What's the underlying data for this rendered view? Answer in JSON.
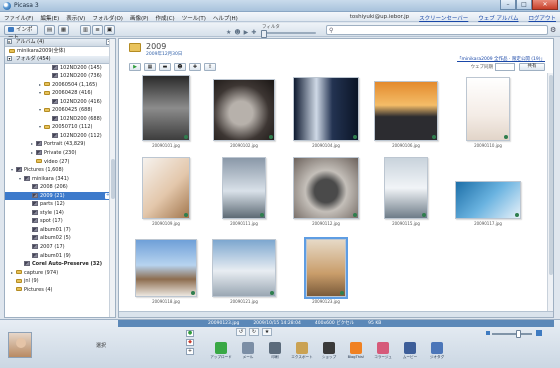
{
  "window": {
    "title": "Picasa 3",
    "controls": {
      "minimize": "–",
      "maximize": "□",
      "close": "✕"
    }
  },
  "menu": {
    "items": [
      "ファイル(F)",
      "編集(E)",
      "表示(V)",
      "フォルダ(O)",
      "画像(P)",
      "作成(C)",
      "ツール(T)",
      "ヘルプ(H)"
    ],
    "email": "toshiyuki@up.iebor.jp",
    "links": [
      "スクリーンセーバー",
      "ウェブ アルバム",
      "ログアウト"
    ]
  },
  "toolbar": {
    "import_label": "インポート",
    "filter_label": "フィルタ",
    "search_placeholder": ""
  },
  "tree": {
    "albums_header": "アルバム (4)",
    "folders_header": "フォルダ (454)",
    "rows": [
      {
        "label": "minikara2009(全体)",
        "indent": 4,
        "kind": "folder",
        "tri": ""
      },
      {
        "label": "102ND200 (145)",
        "indent": 42,
        "kind": "thumb",
        "tri": ""
      },
      {
        "label": "102ND200 (736)",
        "indent": 42,
        "kind": "thumb",
        "tri": ""
      },
      {
        "label": "20060504 (1,165)",
        "indent": 34,
        "kind": "folder",
        "tri": "▸"
      },
      {
        "label": "20060428 (416)",
        "indent": 34,
        "kind": "folder",
        "tri": "▾"
      },
      {
        "label": "102ND200 (416)",
        "indent": 42,
        "kind": "thumb",
        "tri": ""
      },
      {
        "label": "20060425 (688)",
        "indent": 34,
        "kind": "folder",
        "tri": "▾"
      },
      {
        "label": "102ND200 (688)",
        "indent": 42,
        "kind": "thumb",
        "tri": ""
      },
      {
        "label": "20050710 (112)",
        "indent": 34,
        "kind": "folder",
        "tri": "▾"
      },
      {
        "label": "102ND200 (112)",
        "indent": 42,
        "kind": "thumb",
        "tri": ""
      },
      {
        "label": "Portrait (43,829)",
        "indent": 26,
        "kind": "thumb",
        "tri": "▸"
      },
      {
        "label": "Private (230)",
        "indent": 26,
        "kind": "thumb",
        "tri": "▸"
      },
      {
        "label": "video (27)",
        "indent": 26,
        "kind": "folder",
        "tri": ""
      },
      {
        "label": "Pictures (1,608)",
        "indent": 6,
        "kind": "thumb",
        "tri": "▾"
      },
      {
        "label": "minikara (341)",
        "indent": 14,
        "kind": "thumb",
        "tri": "▾"
      },
      {
        "label": "2008 (206)",
        "indent": 22,
        "kind": "thumb",
        "tri": ""
      },
      {
        "label": "2009 (21)",
        "indent": 22,
        "kind": "thumb",
        "tri": "",
        "selected": true
      },
      {
        "label": "parts (12)",
        "indent": 22,
        "kind": "thumb",
        "tri": ""
      },
      {
        "label": "style (14)",
        "indent": 22,
        "kind": "thumb",
        "tri": ""
      },
      {
        "label": "spot (17)",
        "indent": 22,
        "kind": "thumb",
        "tri": ""
      },
      {
        "label": "album01 (7)",
        "indent": 22,
        "kind": "thumb",
        "tri": ""
      },
      {
        "label": "album02 (5)",
        "indent": 22,
        "kind": "thumb",
        "tri": ""
      },
      {
        "label": "2007 (17)",
        "indent": 22,
        "kind": "thumb",
        "tri": ""
      },
      {
        "label": "album01 (9)",
        "indent": 22,
        "kind": "thumb",
        "tri": ""
      },
      {
        "label": "Corel Auto-Preserve (32)",
        "indent": 14,
        "kind": "thumb",
        "tri": "",
        "bold": true
      },
      {
        "label": "capture (974)",
        "indent": 6,
        "kind": "folder",
        "tri": "▸"
      },
      {
        "label": "jnl (9)",
        "indent": 6,
        "kind": "folder",
        "tri": ""
      },
      {
        "label": "Pictures (4)",
        "indent": 6,
        "kind": "folder",
        "tri": ""
      }
    ]
  },
  "album": {
    "name": "2009",
    "date": "2009年12月30日",
    "share_link": "「minikara2009 全作品 · 限定公開 (19)」",
    "web_album_label": "ウェブ同期",
    "sync_label": "共有"
  },
  "photos": [
    {
      "caption": "20090101.jpg",
      "w": 48,
      "h": 66,
      "bg": "linear-gradient(#2a2a2a, #8c8c8c 50%, #3d3d3d)"
    },
    {
      "caption": "20090102.jpg",
      "w": 62,
      "h": 62,
      "bg": "radial-gradient(circle at 45% 55%, #b7b1ab 0 25%, #3d3633 60%, #1a1614)"
    },
    {
      "caption": "20090104.jpg",
      "w": 66,
      "h": 64,
      "bg": "linear-gradient(90deg, #0e1a30, #cfd9e6 35%, #233352 60%, #0b1526)"
    },
    {
      "caption": "20090106.jpg",
      "w": 64,
      "h": 60,
      "bg": "linear-gradient(#e38a2d, #f4bd68 40%, #2c2c30 60%)"
    },
    {
      "caption": "20090110.jpg",
      "w": 44,
      "h": 64,
      "bg": "linear-gradient(#ffffff, #f4ece6 60%, #e2d5c9)"
    },
    {
      "caption": "20090109.jpg",
      "w": 48,
      "h": 62,
      "bg": "linear-gradient(135deg, #f6f2ee, #e3c7ab 55%, #a2774e)"
    },
    {
      "caption": "20090111.jpg",
      "w": 44,
      "h": 62,
      "bg": "linear-gradient(#8a98a8, #d9e1e9 55%, #5d6a74)"
    },
    {
      "caption": "20090112.jpg",
      "w": 66,
      "h": 62,
      "bg": "radial-gradient(circle at 50% 55%, #4a4a4a 0 25%, #c4bfb9 45%, #6c625c)"
    },
    {
      "caption": "20090115.jpg",
      "w": 44,
      "h": 62,
      "bg": "linear-gradient(#c9d3dc, #f1f4f7 50%, #6e7c88)"
    },
    {
      "caption": "20090117.jpg",
      "w": 66,
      "h": 38,
      "bg": "linear-gradient(135deg, #1d6fa8, #6ab3e0 50%, #e7f1f9)"
    },
    {
      "caption": "20090118.jpg",
      "w": 62,
      "h": 58,
      "bg": "linear-gradient(#6fa0d8, #b7d3ef 45%, #8d6d4f 70%, #ece7e0)"
    },
    {
      "caption": "20090121.jpg",
      "w": 64,
      "h": 58,
      "bg": "linear-gradient(#7da7cf, #e8edf2 55%, #9aa7b3)"
    },
    {
      "caption": "20090123.jpg",
      "w": 40,
      "h": 58,
      "bg": "linear-gradient(#e6d9c6, #c99d6a 60%, #7a5a3a)"
    }
  ],
  "info_bar": {
    "file": "20090123.jpg",
    "date": "2009/10/15 14:28:04",
    "size": "400x600 ピクセル",
    "weight": "95 KB"
  },
  "tray": {
    "label": "選択",
    "actions": [
      {
        "label": "アップロード",
        "color": "#39a845"
      },
      {
        "label": "メール",
        "color": "#7b8ea5"
      },
      {
        "label": "印刷",
        "color": "#5b6b7b"
      },
      {
        "label": "エクスポート",
        "color": "#caa253"
      },
      {
        "label": "ショップ",
        "color": "#3a3a3a"
      },
      {
        "label": "BlogThis!",
        "color": "#f08122"
      },
      {
        "label": "コラージュ",
        "color": "#d65a7a"
      },
      {
        "label": "ムービー",
        "color": "#3d5e99"
      },
      {
        "label": "ジオタグ",
        "color": "#4b76b9"
      }
    ]
  },
  "colors": {
    "accent": "#3d7acb",
    "info_bar": "#5b88b8",
    "link": "#1a48a8"
  }
}
